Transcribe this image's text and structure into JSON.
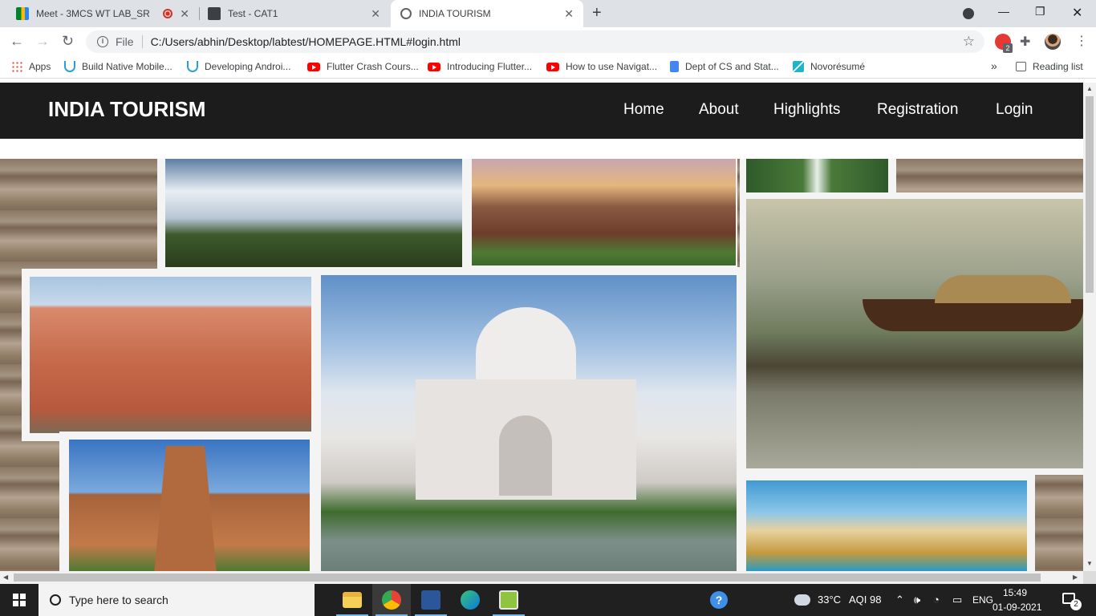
{
  "browser": {
    "tabs": [
      {
        "title": "Meet - 3MCS WT LAB_SR",
        "recording": true
      },
      {
        "title": "Test - CAT1"
      },
      {
        "title": "INDIA TOURISM",
        "active": true
      }
    ],
    "address": {
      "scheme_label": "File",
      "url": "C:/Users/abhin/Desktop/labtest/HOMEPAGE.HTML#login.html"
    },
    "extension_badge": "2",
    "bookmarks": [
      {
        "label": "Apps",
        "icon": "apps-grid-icon"
      },
      {
        "label": "Build Native Mobile...",
        "icon": "udemy-icon"
      },
      {
        "label": "Developing Androi...",
        "icon": "udemy-icon"
      },
      {
        "label": "Flutter Crash Cours...",
        "icon": "youtube-icon"
      },
      {
        "label": "Introducing Flutter...",
        "icon": "youtube-icon"
      },
      {
        "label": "How to use Navigat...",
        "icon": "youtube-icon"
      },
      {
        "label": "Dept of CS and Stat...",
        "icon": "docs-icon"
      },
      {
        "label": "Novorésumé",
        "icon": "novoresume-icon"
      }
    ],
    "reading_list": "Reading list",
    "overflow": "»"
  },
  "site": {
    "brand": "INDIA TOURISM",
    "nav": [
      "Home",
      "About",
      "Highlights",
      "Registration",
      "Login"
    ]
  },
  "taskbar": {
    "search_placeholder": "Type here to search",
    "weather": "33°C",
    "aqi": "AQI 98",
    "language": "ENG",
    "time": "15:49",
    "date": "01-09-2021",
    "notifications": "2"
  },
  "colors": {
    "site_nav_bg": "#1c1c1c",
    "tab_strip": "#dee1e6",
    "taskbar": "#202020"
  }
}
